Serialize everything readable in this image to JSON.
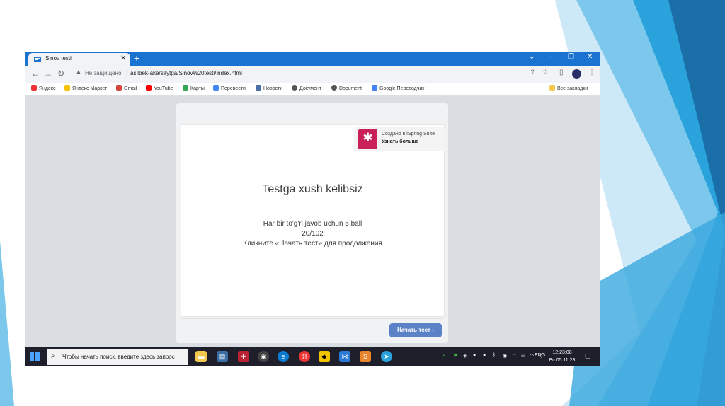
{
  "colors": {
    "tab_bar": "#1a73d0",
    "primary_button": "#5b81c6",
    "ispring_brand": "#c9205a",
    "taskbar": "#1f1f2c"
  },
  "browser": {
    "tab_title": "Sinov testi",
    "new_tab_icon": "plus-icon",
    "not_secure_label": "Не защищено",
    "url": "asilbek-aka/saytga/Sinov%20testi/index.html"
  },
  "bookmarks": {
    "items": [
      {
        "label": "Яндекс",
        "icon": "yandex-icon",
        "color": "#e33"
      },
      {
        "label": "Яндекс Маркет",
        "icon": "market-icon",
        "color": "#f5c400"
      },
      {
        "label": "Gmail",
        "icon": "gmail-icon",
        "color": "#d44638"
      },
      {
        "label": "YouTube",
        "icon": "youtube-icon",
        "color": "#ff0000"
      },
      {
        "label": "Карты",
        "icon": "maps-icon",
        "color": "#34a853"
      },
      {
        "label": "Перевести",
        "icon": "translate-icon",
        "color": "#4285f4"
      },
      {
        "label": "Новости",
        "icon": "news-icon",
        "color": "#4a6fa5"
      },
      {
        "label": "Документ",
        "icon": "globe-icon",
        "color": "#555"
      },
      {
        "label": "Document",
        "icon": "globe-icon",
        "color": "#555"
      },
      {
        "label": "Google Переводчик",
        "icon": "translate-icon",
        "color": "#4285f4"
      }
    ],
    "all_bookmarks": "Все закладки"
  },
  "player": {
    "ispring_made": "Создано в iSpring Suite",
    "ispring_more": "Узнать больше",
    "title": "Testga xush kelibsiz",
    "line1": "Har bir to'g'ri javob uchun 5 ball",
    "line2": "20/102",
    "line3": "Кликните «Начать тест» для продолжения",
    "start_button": "Начать тест"
  },
  "taskbar": {
    "search_placeholder": "Чтобы начать поиск, введите здесь запрос",
    "lang": "ENG",
    "time": "12:23:08",
    "date": "Вс 05.11.23"
  }
}
